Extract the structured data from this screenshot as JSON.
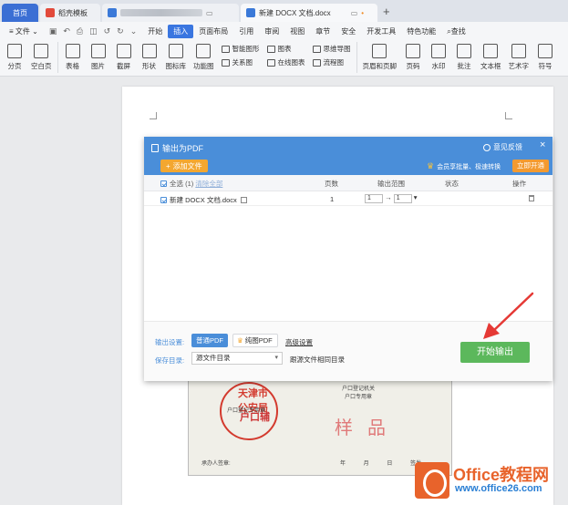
{
  "tabs": {
    "home": "首页",
    "template": "稻壳模板",
    "document": "新建 DOCX 文档.docx",
    "add": "+"
  },
  "menu": {
    "file": "文件",
    "items": [
      "开始",
      "插入",
      "页面布局",
      "引用",
      "审阅",
      "视图",
      "章节",
      "安全",
      "开发工具",
      "特色功能"
    ],
    "search": "查找"
  },
  "ribbon": {
    "page_break": "分页",
    "blank_page": "空白页",
    "table": "表格",
    "picture": "图片",
    "screenshot": "截屏",
    "shape": "形状",
    "icon_lib": "图标库",
    "function_chart": "功能图",
    "smart_shape": "智能图形",
    "chart": "图表",
    "mind_map": "思维导图",
    "relation_chart": "关系图",
    "online_chart": "在线图表",
    "flow_chart": "流程图",
    "header_footer": "页眉和页脚",
    "page_number": "页码",
    "watermark": "水印",
    "comment": "批注",
    "textbox": "文本框",
    "word_art": "艺术字",
    "symbol": "符号"
  },
  "dialog": {
    "title": "输出为PDF",
    "feedback": "意见反馈",
    "close": "×",
    "add_file": "添加文件",
    "vip_note": "会员享批量、极速转换",
    "vip_button": "立即开通",
    "headers": {
      "select_all": "全选 (1)",
      "clear_all": "清除全部",
      "pages": "页数",
      "range": "输出范围",
      "status": "状态",
      "action": "操作"
    },
    "row": {
      "filename": "新建 DOCX 文档.docx",
      "pages": "1",
      "range_from": "1",
      "range_to": "1",
      "arrow": "→"
    },
    "footer": {
      "output_label": "输出设置:",
      "normal_pdf": "普通PDF",
      "image_pdf": "纯图PDF",
      "advanced": "高级设置",
      "save_label": "保存目录:",
      "save_dir": "源文件目录",
      "same_dir": "跟源文件相同目录",
      "start": "开始输出"
    }
  },
  "certificate": {
    "seal_text": "天津市公安局",
    "seal_inner": "户口登记专用章",
    "registry": [
      "户口登记机关",
      "户口专用章"
    ],
    "stamp_word": "户口辅",
    "sample": "样品",
    "signer": "承办人签章:",
    "date": "年 月 日 签发"
  },
  "watermark": {
    "title": "Office教程网",
    "url": "www.office26.com"
  },
  "colors": {
    "accent": "#4a8ed9",
    "start_button": "#5cb85c",
    "add_file": "#f3a730",
    "arrow": "#e53935",
    "logo": "#e8632b"
  }
}
